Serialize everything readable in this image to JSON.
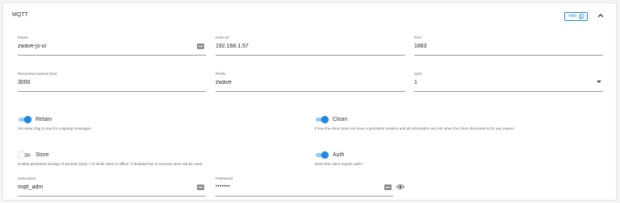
{
  "section": {
    "title": "MQTT",
    "badge_label": "mqtt"
  },
  "fields": {
    "name": {
      "label": "Name",
      "value": "zwave-js-ui"
    },
    "host": {
      "label": "Host url",
      "value": "192.168.1.57"
    },
    "port": {
      "label": "Port",
      "value": "1883"
    },
    "reconnect": {
      "label": "Reconnect period (ms)",
      "value": "3000"
    },
    "prefix": {
      "label": "Prefix",
      "value": "zwave"
    },
    "qos": {
      "label": "QoS",
      "value": "1"
    },
    "username": {
      "label": "Username",
      "value": "mqtt_adm"
    },
    "password": {
      "label": "Password",
      "value": "•••••••"
    }
  },
  "toggles": {
    "retain": {
      "label": "Retain",
      "on": true,
      "hint": "Set retain flag to true for outgoing messages"
    },
    "clean": {
      "label": "Clean",
      "on": true,
      "hint": "If true the client does not have a persistent session and all information are lost when the client disconnects for any reason"
    },
    "store": {
      "label": "Store",
      "on": false,
      "hint": "Enable persistent storage of packets (QoS > 0) while client is offline. If disabled the in memory store will be used."
    },
    "auth": {
      "label": "Auth",
      "on": true,
      "hint": "Does this client require auth?"
    }
  },
  "colors": {
    "accent": "#1e88e5",
    "accent_light": "#90caf9"
  },
  "icons": [
    "content-copy-icon",
    "chevron-up-icon",
    "keyboard-icon",
    "eye-icon",
    "menu-down-icon"
  ]
}
